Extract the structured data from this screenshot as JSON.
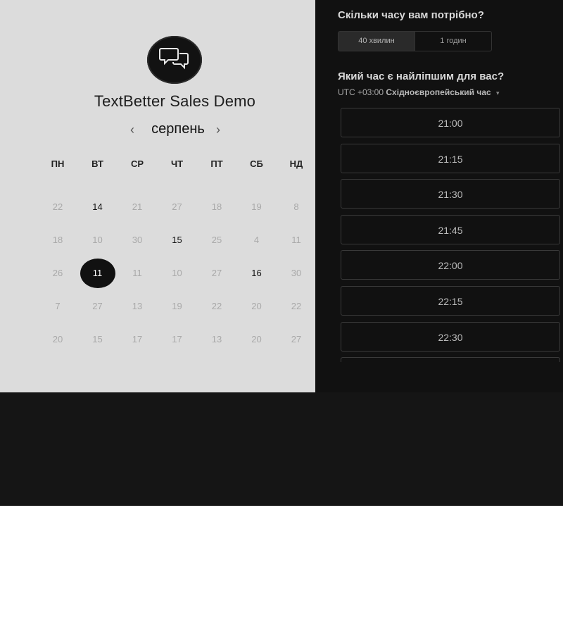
{
  "title": "TextBetter Sales Demo",
  "calendar": {
    "month": "серпень",
    "prev_icon": "‹",
    "next_icon": "›",
    "weekdays": [
      "ПН",
      "ВТ",
      "СР",
      "ЧТ",
      "ПТ",
      "СБ",
      "НД"
    ],
    "weeks": [
      [
        "22",
        "14",
        "21",
        "27",
        "18",
        "19",
        "8"
      ],
      [
        "18",
        "10",
        "30",
        "15",
        "25",
        "4",
        "11"
      ],
      [
        "26",
        "11",
        "11",
        "10",
        "27",
        "16",
        "30"
      ],
      [
        "7",
        "27",
        "13",
        "19",
        "22",
        "20",
        "22"
      ],
      [
        "20",
        "15",
        "17",
        "17",
        "13",
        "20",
        "27"
      ]
    ],
    "available": [
      [
        0,
        1
      ],
      [
        1,
        3
      ],
      [
        2,
        5
      ]
    ],
    "selected": [
      2,
      1
    ]
  },
  "duration": {
    "heading": "Скільки часу вам потрібно?",
    "options": [
      "40 хвилин",
      "1 годин"
    ],
    "selected_index": 0
  },
  "time": {
    "heading": "Який час є найліпшим для вас?",
    "tz_prefix": "UTC +03:00",
    "tz_name": "Східноєвропейський час",
    "slots": [
      "21:00",
      "21:15",
      "21:30",
      "21:45",
      "22:00",
      "22:15",
      "22:30",
      ""
    ]
  },
  "icons": {
    "logo": "chat-bubbles-icon",
    "tz_caret": "▾"
  },
  "colors": {
    "left_bg": "#dcdcdc",
    "right_bg": "#111111",
    "selected_day": "#111111"
  }
}
